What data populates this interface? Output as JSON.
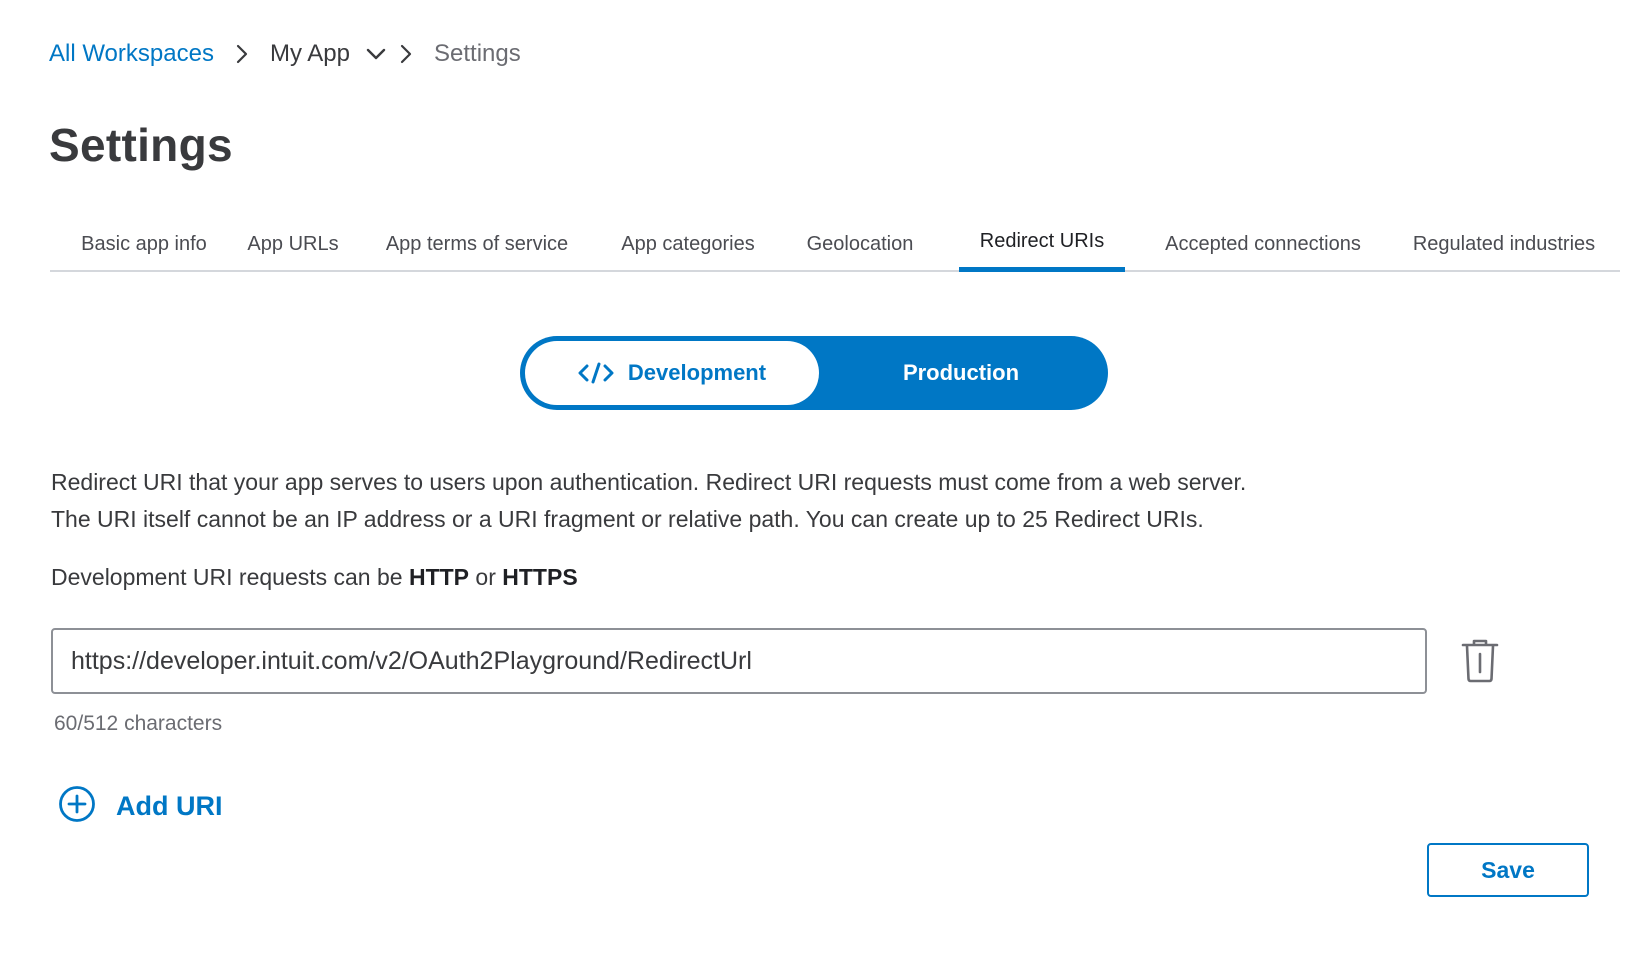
{
  "breadcrumb": {
    "workspaces": "All Workspaces",
    "app": "My App",
    "current": "Settings"
  },
  "page": {
    "title": "Settings"
  },
  "tabs": [
    {
      "label": "Basic app info",
      "active": false
    },
    {
      "label": "App URLs",
      "active": false
    },
    {
      "label": "App terms of service",
      "active": false
    },
    {
      "label": "App categories",
      "active": false
    },
    {
      "label": "Geolocation",
      "active": false
    },
    {
      "label": "Redirect URIs",
      "active": true
    },
    {
      "label": "Accepted connections",
      "active": false
    },
    {
      "label": "Regulated industries",
      "active": false
    }
  ],
  "environment": {
    "development": "Development",
    "production": "Production",
    "selected": "Development"
  },
  "description": {
    "line1": "Redirect URI that your app serves to users upon authentication. Redirect URI requests must come from a web server.",
    "line2": "The URI itself cannot be an IP address or a URI fragment or relative path. You can create up to 25 Redirect URIs."
  },
  "protocol": {
    "prefix": "Development URI requests can be",
    "http": "HTTP",
    "or": "or",
    "https": "HTTPS"
  },
  "redirect_uris": [
    {
      "value": "https://developer.intuit.com/v2/OAuth2Playground/RedirectUrl",
      "char_count": "60/512 characters"
    }
  ],
  "actions": {
    "add_uri": "Add URI",
    "save": "Save"
  },
  "icons": {
    "chevron_right": "chevron-right-icon",
    "chevron_down": "chevron-down-icon",
    "code": "code-icon",
    "trash": "trash-icon",
    "add": "plus-circle-icon"
  },
  "colors": {
    "accent": "#0077c5",
    "text": "#393a3d",
    "muted": "#6b6c72",
    "divider": "#d4d7dc"
  }
}
